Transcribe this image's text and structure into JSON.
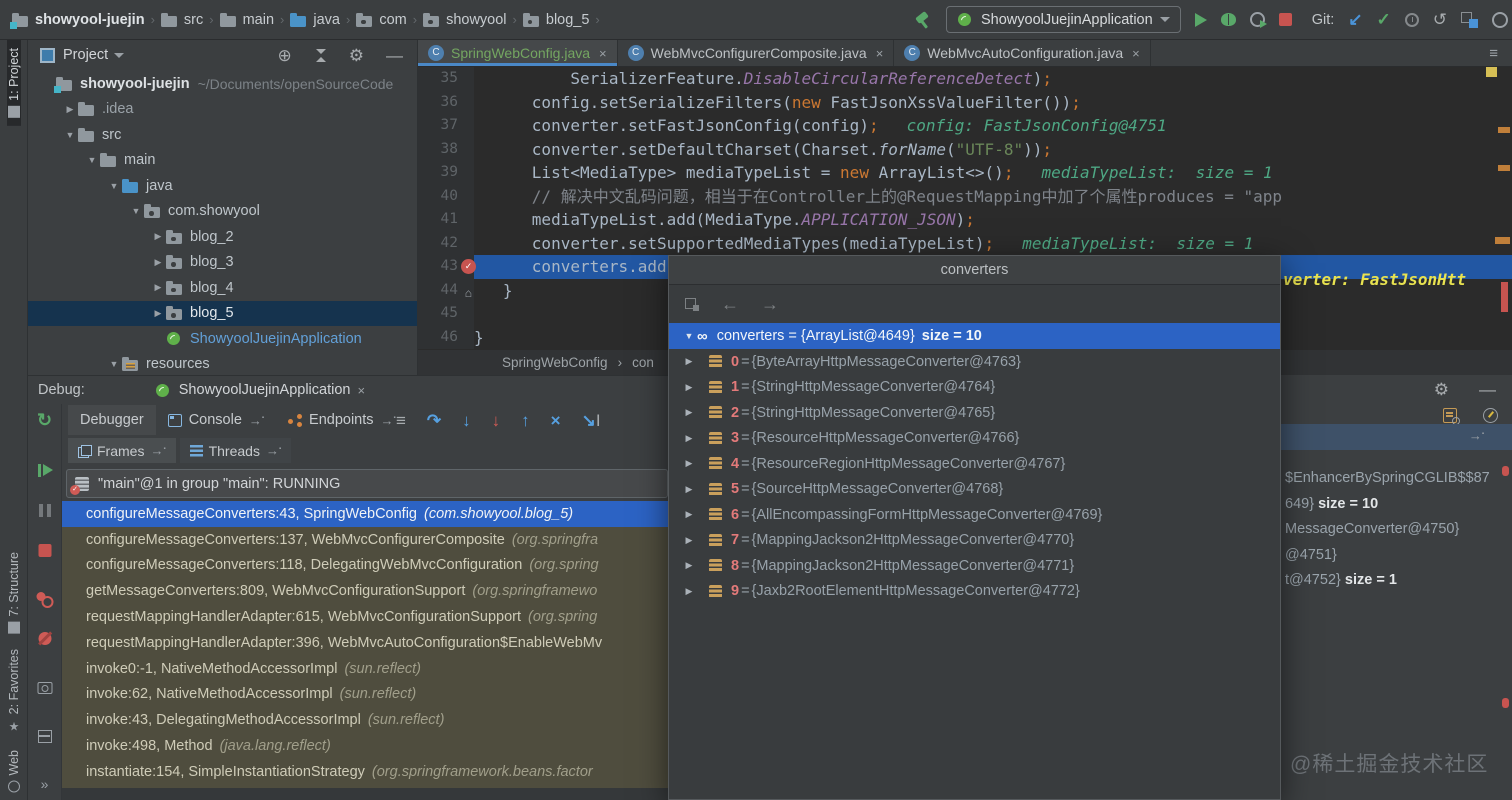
{
  "colors": {
    "selection_blue": "#2c63c4",
    "exec_line_blue": "#2257a3",
    "breakpoint_red": "#c75450",
    "run_green": "#59a869",
    "frames_bg_olive": "#4f4d3e",
    "accent_tab_underline": "#4a88c7"
  },
  "topbar": {
    "breadcrumbs": [
      {
        "label": "showyool-juejin",
        "icon": "project"
      },
      {
        "label": "src",
        "icon": "folder"
      },
      {
        "label": "main",
        "icon": "folder"
      },
      {
        "label": "java",
        "icon": "folder-blue"
      },
      {
        "label": "com",
        "icon": "package"
      },
      {
        "label": "showyool",
        "icon": "package"
      },
      {
        "label": "blog_5",
        "icon": "package"
      }
    ],
    "run_config_label": "ShowyoolJuejinApplication",
    "git_label": "Git:"
  },
  "tool_strip": {
    "project": "1: Project",
    "structure": "7: Structure",
    "favorites": "2: Favorites",
    "web": "Web"
  },
  "project_panel": {
    "title": "Project",
    "tree": [
      {
        "label": "showyool-juejin",
        "path": "~/Documents/openSourceCode",
        "icon": "project",
        "depth": 0,
        "arrow": "",
        "bold": true
      },
      {
        "label": ".idea",
        "icon": "folder",
        "depth": 1,
        "arrow": "right",
        "dim": true
      },
      {
        "label": "src",
        "icon": "folder",
        "depth": 1,
        "arrow": "down"
      },
      {
        "label": "main",
        "icon": "folder",
        "depth": 2,
        "arrow": "down"
      },
      {
        "label": "java",
        "icon": "folder-blue",
        "depth": 3,
        "arrow": "down"
      },
      {
        "label": "com.showyool",
        "icon": "package",
        "depth": 4,
        "arrow": "down"
      },
      {
        "label": "blog_2",
        "icon": "package",
        "depth": 5,
        "arrow": "right"
      },
      {
        "label": "blog_3",
        "icon": "package",
        "depth": 5,
        "arrow": "right"
      },
      {
        "label": "blog_4",
        "icon": "package",
        "depth": 5,
        "arrow": "right"
      },
      {
        "label": "blog_5",
        "icon": "package",
        "depth": 5,
        "arrow": "right",
        "selected": true
      },
      {
        "label": "ShowyoolJuejinApplication",
        "icon": "spring",
        "depth": 5,
        "arrow": "",
        "accent": true
      },
      {
        "label": "resources",
        "icon": "folder-res",
        "depth": 3,
        "arrow": "down"
      }
    ]
  },
  "editor": {
    "tabs": [
      {
        "label": "SpringWebConfig.java",
        "active": true
      },
      {
        "label": "WebMvcConfigurerComposite.java",
        "active": false
      },
      {
        "label": "WebMvcAutoConfiguration.java",
        "active": false
      }
    ],
    "close_glyph": "×",
    "breadcrumb": [
      "SpringWebConfig",
      "con"
    ],
    "exec_hint_fragment": "verter: FastJsonHtt",
    "lines": [
      {
        "num": 35,
        "segs": [
          [
            "          ",
            "p"
          ],
          [
            "SerializerFeature.",
            "p"
          ],
          [
            "DisableCircularReferenceDetect",
            "f"
          ],
          [
            ")",
            "p"
          ],
          [
            ";",
            "k"
          ]
        ]
      },
      {
        "num": 36,
        "segs": [
          [
            "      ",
            "p"
          ],
          [
            "config.setSerializeFilters(",
            "p"
          ],
          [
            "new",
            "k"
          ],
          [
            " FastJsonXssValueFilter())",
            "p"
          ],
          [
            ";",
            "k"
          ]
        ]
      },
      {
        "num": 37,
        "segs": [
          [
            "      ",
            "p"
          ],
          [
            "converter.setFastJsonConfig(config)",
            "p"
          ],
          [
            ";",
            "k"
          ]
        ],
        "hint": "config: FastJsonConfig@4751"
      },
      {
        "num": 38,
        "segs": [
          [
            "      ",
            "p"
          ],
          [
            "converter.setDefaultCharset(Charset.",
            "p"
          ],
          [
            "forName",
            "m"
          ],
          [
            "(",
            "p"
          ],
          [
            "\"UTF-8\"",
            "s"
          ],
          [
            "))",
            "p"
          ],
          [
            ";",
            "k"
          ]
        ]
      },
      {
        "num": 39,
        "segs": [
          [
            "      ",
            "p"
          ],
          [
            "List<MediaType> mediaTypeList = ",
            "p"
          ],
          [
            "new",
            "k"
          ],
          [
            " ArrayList<>()",
            "p"
          ],
          [
            ";",
            "k"
          ]
        ],
        "hint": "mediaTypeList:  size = 1"
      },
      {
        "num": 40,
        "segs": [
          [
            "      ",
            "p"
          ],
          [
            "// 解决中文乱码问题，相当于在Controller上的@RequestMapping中加了个属性produces = \"app",
            "c"
          ]
        ]
      },
      {
        "num": 41,
        "segs": [
          [
            "      ",
            "p"
          ],
          [
            "mediaTypeList.add(MediaType.",
            "p"
          ],
          [
            "APPLICATION_JSON",
            "f"
          ],
          [
            ")",
            "p"
          ],
          [
            ";",
            "k"
          ]
        ]
      },
      {
        "num": 42,
        "segs": [
          [
            "      ",
            "p"
          ],
          [
            "converter.setSupportedMediaTypes(mediaTypeList)",
            "p"
          ],
          [
            ";",
            "k"
          ]
        ],
        "hint": "mediaTypeList:  size = 1"
      },
      {
        "num": 43,
        "segs": [
          [
            "      ",
            "p"
          ],
          [
            "converters.add(converter)",
            "p"
          ],
          [
            ";",
            "k"
          ]
        ],
        "exec": true,
        "breakpoint": true
      },
      {
        "num": 44,
        "segs": [
          [
            "   ",
            "p"
          ],
          [
            "}",
            "p"
          ]
        ],
        "mark": true
      },
      {
        "num": 45,
        "segs": []
      },
      {
        "num": 46,
        "segs": [
          [
            "}",
            "p"
          ]
        ]
      }
    ]
  },
  "debug": {
    "label": "Debug:",
    "session": "ShowyoolJuejinApplication",
    "tabs": [
      "Debugger",
      "Console",
      "Endpoints"
    ],
    "view_tabs": [
      "Frames",
      "Threads"
    ],
    "thread_status": "\"main\"@1 in group \"main\": RUNNING",
    "frames": [
      {
        "text": "configureMessageConverters:43, SpringWebConfig",
        "loc": "(com.showyool.blog_5)",
        "selected": true
      },
      {
        "text": "configureMessageConverters:137, WebMvcConfigurerComposite",
        "loc": "(org.springfra"
      },
      {
        "text": "configureMessageConverters:118, DelegatingWebMvcConfiguration",
        "loc": "(org.spring"
      },
      {
        "text": "getMessageConverters:809, WebMvcConfigurationSupport",
        "loc": "(org.springframewo"
      },
      {
        "text": "requestMappingHandlerAdapter:615, WebMvcConfigurationSupport",
        "loc": "(org.spring"
      },
      {
        "text": "requestMappingHandlerAdapter:396, WebMvcAutoConfiguration$EnableWebMv",
        "loc": ""
      },
      {
        "text": "invoke0:-1, NativeMethodAccessorImpl",
        "loc": "(sun.reflect)"
      },
      {
        "text": "invoke:62, NativeMethodAccessorImpl",
        "loc": "(sun.reflect)"
      },
      {
        "text": "invoke:43, DelegatingMethodAccessorImpl",
        "loc": "(sun.reflect)"
      },
      {
        "text": "invoke:498, Method",
        "loc": "(java.lang.reflect)"
      },
      {
        "text": "instantiate:154, SimpleInstantiationStrategy",
        "loc": "(org.springframework.beans.factor"
      }
    ]
  },
  "popup": {
    "title": "converters",
    "root_name": "converters = {ArrayList@4649}",
    "root_size": "size = 10",
    "items": [
      {
        "index": "0",
        "value": "{ByteArrayHttpMessageConverter@4763}"
      },
      {
        "index": "1",
        "value": "{StringHttpMessageConverter@4764}"
      },
      {
        "index": "2",
        "value": "{StringHttpMessageConverter@4765}"
      },
      {
        "index": "3",
        "value": "{ResourceHttpMessageConverter@4766}"
      },
      {
        "index": "4",
        "value": "{ResourceRegionHttpMessageConverter@4767}"
      },
      {
        "index": "5",
        "value": "{SourceHttpMessageConverter@4768}"
      },
      {
        "index": "6",
        "value": "{AllEncompassingFormHttpMessageConverter@4769}"
      },
      {
        "index": "7",
        "value": "{MappingJackson2HttpMessageConverter@4770}"
      },
      {
        "index": "8",
        "value": "{MappingJackson2HttpMessageConverter@4771}"
      },
      {
        "index": "9",
        "value": "{Jaxb2RootElementHttpMessageConverter@4772}"
      }
    ]
  },
  "variables": {
    "fragments": [
      {
        "pre": "$EnhancerBySpringCGLIB$$87",
        "bold": ""
      },
      {
        "pre": "649}  ",
        "bold": "size = 10"
      },
      {
        "pre": "MessageConverter@4750}",
        "bold": ""
      },
      {
        "pre": "@4751}",
        "bold": ""
      },
      {
        "pre": "t@4752}  ",
        "bold": "size = 1"
      }
    ]
  },
  "watermark": "@稀土掘金技术社区"
}
